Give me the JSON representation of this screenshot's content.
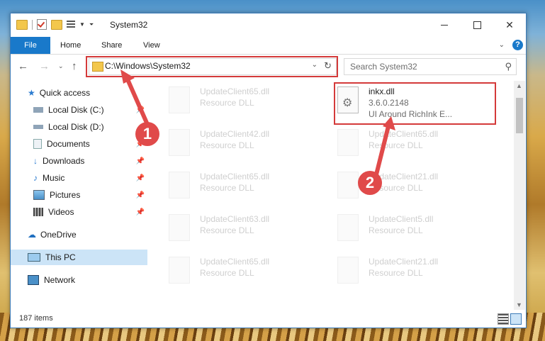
{
  "window": {
    "title": "System32",
    "minimize_label": "—",
    "maximize_label": "",
    "close_label": "✕"
  },
  "ribbon": {
    "tabs": [
      "File",
      "Home",
      "Share",
      "View"
    ],
    "help_label": "?"
  },
  "nav": {
    "address": "C:\\Windows\\System32",
    "search_placeholder": "Search System32"
  },
  "sidebar": {
    "items": [
      {
        "label": "Quick access",
        "icon": "star-icon",
        "pinned": false
      },
      {
        "label": "Local Disk (C:)",
        "icon": "drive-icon",
        "pinned": true
      },
      {
        "label": "Local Disk (D:)",
        "icon": "drive-icon",
        "pinned": false
      },
      {
        "label": "Documents",
        "icon": "documents-icon",
        "pinned": true
      },
      {
        "label": "Downloads",
        "icon": "download-icon",
        "pinned": true
      },
      {
        "label": "Music",
        "icon": "music-icon",
        "pinned": true
      },
      {
        "label": "Pictures",
        "icon": "pictures-icon",
        "pinned": true
      },
      {
        "label": "Videos",
        "icon": "videos-icon",
        "pinned": true
      },
      {
        "label": "OneDrive",
        "icon": "onedrive-icon",
        "pinned": false
      },
      {
        "label": "This PC",
        "icon": "pc-icon",
        "pinned": false,
        "selected": true
      },
      {
        "label": "Network",
        "icon": "network-icon",
        "pinned": false
      }
    ]
  },
  "files": {
    "left": [
      {
        "name": "UpdateClient65.dll",
        "type": "Resource DLL"
      },
      {
        "name": "UpdateClient42.dll",
        "type": "Resource DLL"
      },
      {
        "name": "UpdateClient65.dll",
        "type": "Resource DLL"
      },
      {
        "name": "UpdateClient63.dll",
        "type": "Resource DLL"
      },
      {
        "name": "UpdateClient65.dll",
        "type": "Resource DLL"
      }
    ],
    "right": [
      {
        "name": "inkx.dll",
        "version": "3.6.0.2148",
        "description": "UI Around RichInk E...",
        "highlighted": true
      },
      {
        "name": "UpdateClient65.dll",
        "type": "Resource DLL"
      },
      {
        "name": "UpdateClient21.dll",
        "type": "Resource DLL"
      },
      {
        "name": "UpdateClient5.dll",
        "type": "Resource DLL"
      },
      {
        "name": "UpdateClient21.dll",
        "type": "Resource DLL"
      }
    ]
  },
  "status": {
    "item_count": "187 items"
  },
  "annotations": {
    "badge1": "1",
    "badge2": "2",
    "color": "#e04a4a"
  }
}
